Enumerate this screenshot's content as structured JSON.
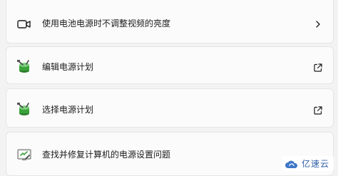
{
  "settings": [
    {
      "label": "使用电池电源时不调整视频的亮度",
      "icon": "video-camera-icon",
      "trailing": "chevron-right-icon"
    },
    {
      "label": "编辑电源计划",
      "icon": "power-plan-battery-icon",
      "trailing": "external-link-icon"
    },
    {
      "label": "选择电源计划",
      "icon": "power-plan-battery-icon",
      "trailing": "external-link-icon"
    },
    {
      "label": "查找并修复计算机的电源设置问题",
      "icon": "troubleshooter-icon",
      "trailing": ""
    }
  ],
  "watermark": {
    "text": "亿速云",
    "logo": "cloud-logo-icon"
  },
  "colors": {
    "background": "#f3f3f3",
    "card": "#fbfbfb",
    "border": "#e5e5e5",
    "watermark": "#2f5fa8",
    "plan_green": "#3aa23a"
  }
}
